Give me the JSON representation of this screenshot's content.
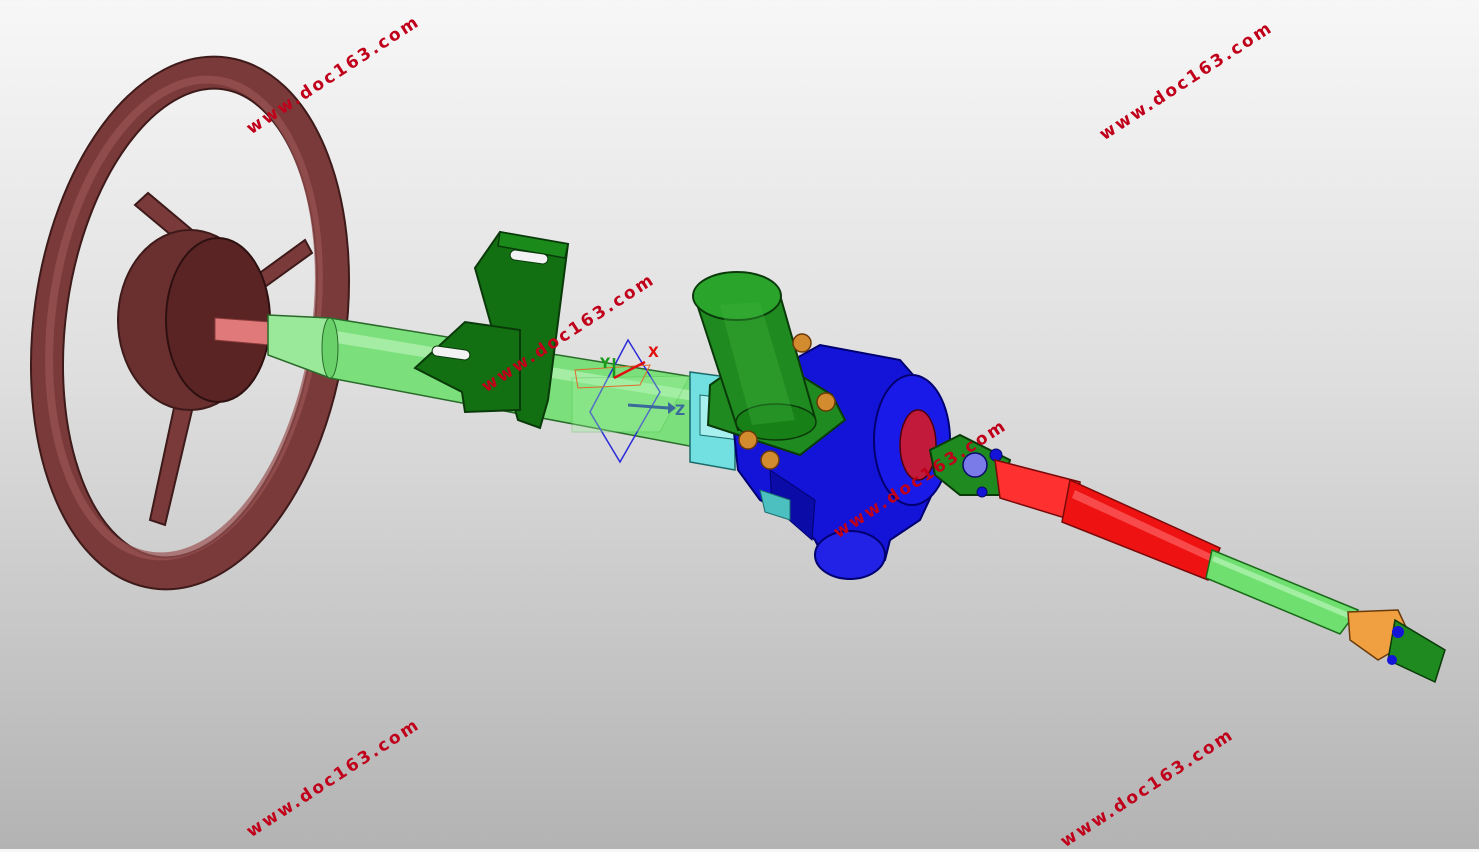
{
  "watermark": "www.doc163.com",
  "triad": {
    "x_label": "X",
    "y_label": "Y",
    "z_label": "Z"
  },
  "colors": {
    "steering_wheel": "#7a3a3a",
    "column_tube": "#7be07b",
    "bracket": "#127012",
    "gearbox": "#1212d8",
    "intermediate_shaft": "#ee1212",
    "lower_shaft": "#6fe06f",
    "end_joint": "#f0a040",
    "motor": "#1f8a1f",
    "bolts": "#d28b2e"
  }
}
